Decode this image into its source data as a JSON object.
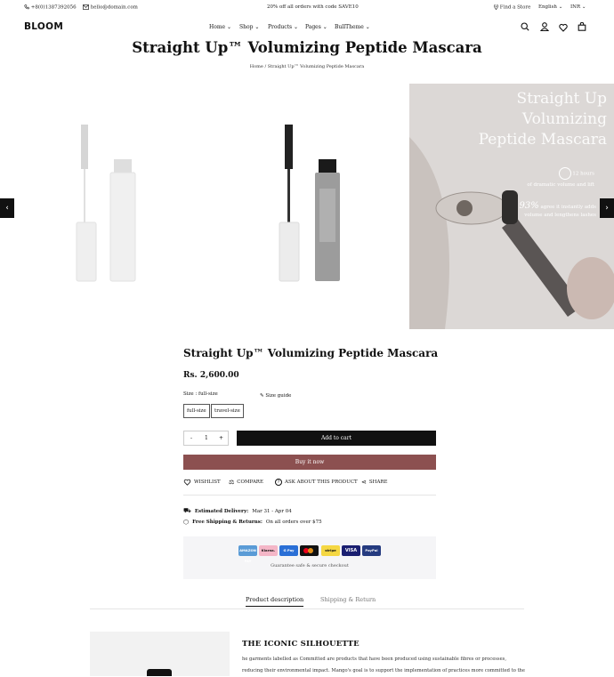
{
  "topbar": {
    "phone": "+8(0)1387392056",
    "email": "hello@domain.com",
    "promo": "20% off all orders with code SAVE10",
    "find_store": "Find a Store",
    "language": "English",
    "currency": "INR"
  },
  "header": {
    "logo": "BLOOM",
    "nav": [
      "Home",
      "Shop",
      "Products",
      "Pages",
      "BullTheme"
    ]
  },
  "page": {
    "title": "Straight Up™ Volumizing Peptide Mascara",
    "breadcrumb": "Home / Straight Up™ Volumizing Peptide Mascara"
  },
  "gallery": {
    "image3_heading": [
      "Straight Up",
      "Volumizing",
      "Peptide Mascara"
    ],
    "image3_hours": "12 hours",
    "image3_hours_caption": "of dramatic volume and lift",
    "image3_stat": "93%",
    "image3_stat_caption": [
      "agree it instantly adds",
      "volume and lengthens lashes"
    ]
  },
  "product": {
    "title": "Straight Up™ Volumizing Peptide Mascara",
    "price": "Rs. 2,600.00",
    "size_label": "Size : full-size",
    "size_guide": "Size guide",
    "options": [
      "full-size",
      "travel-size"
    ],
    "quantity": "1",
    "minus": "-",
    "plus": "+",
    "add_to_cart": "Add to cart",
    "buy_now": "Buy it now",
    "actions": [
      "WISHLIST",
      "COMPARE",
      "ASK ABOUT THIS PRODUCT",
      "SHARE"
    ],
    "delivery_label": "Estimated Delivery:",
    "delivery_value": "Mar 31 - Apr 04",
    "shipping_label": "Free Shipping & Returns:",
    "shipping_value": "On all orders over $75",
    "payments": [
      "AMAZON PAY",
      "Klarna.",
      "G Pay",
      "MC",
      "stripe",
      "VISA",
      "PayPal"
    ],
    "guarantee": "Guarantee safe & secure checkout"
  },
  "tabs": [
    "Product description",
    "Shipping & Return"
  ],
  "section": {
    "title": "THE ICONIC SILHOUETTE",
    "text": "he garments labelled as Committed are products that have been produced using sustainable fibres or processes, reducing their environmental impact. Mango's goal is to support the implementation of practices more committed to the"
  },
  "colors": {
    "accent": "#8c5050",
    "dark": "#111111",
    "paybox": "#f5f5f7"
  }
}
